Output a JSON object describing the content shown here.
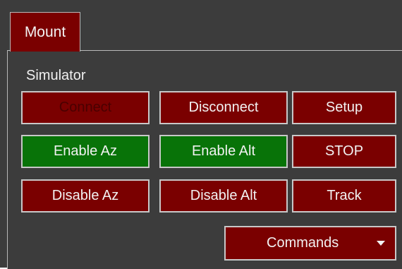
{
  "tabs": [
    {
      "label": "Mount",
      "selected": true
    }
  ],
  "group": {
    "label": "Simulator"
  },
  "buttons": {
    "connect": {
      "label": "Connect",
      "enabled": false
    },
    "disconnect": {
      "label": "Disconnect"
    },
    "setup": {
      "label": "Setup"
    },
    "enable_az": {
      "label": "Enable Az"
    },
    "enable_alt": {
      "label": "Enable Alt"
    },
    "stop": {
      "label": "STOP"
    },
    "disable_az": {
      "label": "Disable Az"
    },
    "disable_alt": {
      "label": "Disable Alt"
    },
    "track": {
      "label": "Track"
    }
  },
  "commands_dropdown": {
    "label": "Commands",
    "icon": "chevron-down-icon"
  },
  "colors": {
    "panel_bg": "#3c3c3c",
    "button_red": "#7a0000",
    "button_green": "#087308",
    "text": "#f2f2f2",
    "border": "#c8c8c8"
  }
}
